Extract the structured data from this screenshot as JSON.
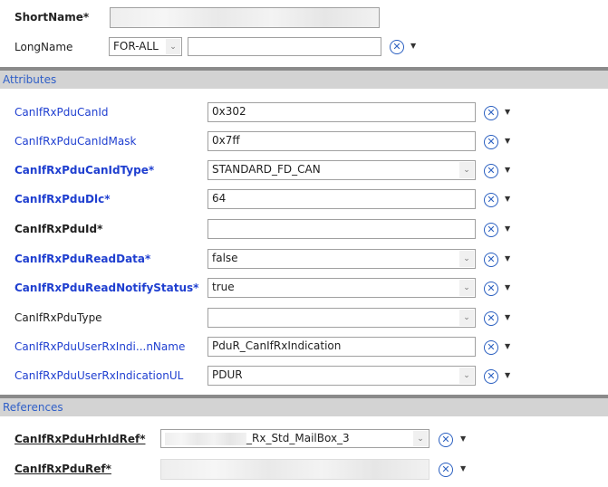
{
  "header": {
    "shortname_label": "ShortName*",
    "longname_label": "LongName",
    "language": "FOR-ALL",
    "longname_value": ""
  },
  "sections": {
    "attributes": "Attributes",
    "references": "References"
  },
  "attributes": [
    {
      "label": "CanIfRxPduCanId",
      "value": "0x302",
      "type": "text",
      "style": "blue"
    },
    {
      "label": "CanIfRxPduCanIdMask",
      "value": "0x7ff",
      "type": "text",
      "style": "blue"
    },
    {
      "label": "CanIfRxPduCanIdType*",
      "value": "STANDARD_FD_CAN",
      "type": "combo",
      "style": "bluebold"
    },
    {
      "label": "CanIfRxPduDlc*",
      "value": "64",
      "type": "text",
      "style": "bluebold"
    },
    {
      "label": "CanIfRxPduId*",
      "value": "",
      "type": "text",
      "style": "bold"
    },
    {
      "label": "CanIfRxPduReadData*",
      "value": "false",
      "type": "combo",
      "style": "bluebold"
    },
    {
      "label": "CanIfRxPduReadNotifyStatus*",
      "value": "true",
      "type": "combo",
      "style": "bluebold"
    },
    {
      "label": "CanIfRxPduType",
      "value": "",
      "type": "combo",
      "style": "plain"
    },
    {
      "label": "CanIfRxPduUserRxIndi...nName",
      "value": "PduR_CanIfRxIndication",
      "type": "text",
      "style": "blue"
    },
    {
      "label": "CanIfRxPduUserRxIndicationUL",
      "value": "PDUR",
      "type": "combo",
      "style": "blue"
    }
  ],
  "references": [
    {
      "label": "CanIfRxPduHrhIdRef*",
      "value": "_Rx_Std_MailBox_3"
    },
    {
      "label": "CanIfRxPduRef*",
      "value": ""
    }
  ],
  "icons": {
    "tool": "wrench-cross-icon",
    "menu": "dropdown-arrow-icon"
  }
}
